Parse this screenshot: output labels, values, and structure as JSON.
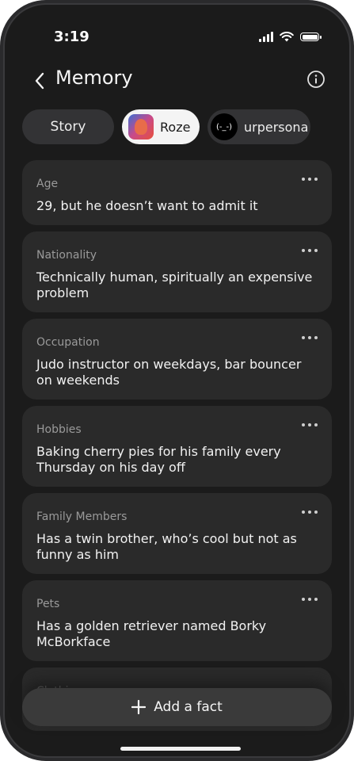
{
  "status_bar": {
    "time": "3:19"
  },
  "header": {
    "title": "Memory"
  },
  "chips": [
    {
      "label": "Story"
    },
    {
      "label": "Roze"
    },
    {
      "label": "urpersona",
      "avatar_text": "(-_-)"
    }
  ],
  "facts": [
    {
      "label": "Age",
      "value": "29, but he doesn’t want to admit it"
    },
    {
      "label": "Nationality",
      "value": "Technically human, spiritually an expensive problem"
    },
    {
      "label": "Occupation",
      "value": "Judo instructor on weekdays, bar bouncer on weekends"
    },
    {
      "label": "Hobbies",
      "value": "Baking cherry pies for his family every Thursday on his day off"
    },
    {
      "label": "Family Members",
      "value": "Has a twin brother, who’s cool but not as funny as him"
    },
    {
      "label": "Pets",
      "value": "Has a golden retriever named Borky McBorkface"
    },
    {
      "label": "Clothing",
      "value": ""
    }
  ],
  "add_fact": {
    "label": "Add a fact"
  },
  "colors": {
    "background": "#1b1b1b",
    "card": "#2a2a2a",
    "chip": "#333335",
    "selected_chip": "#f4f4f4"
  }
}
